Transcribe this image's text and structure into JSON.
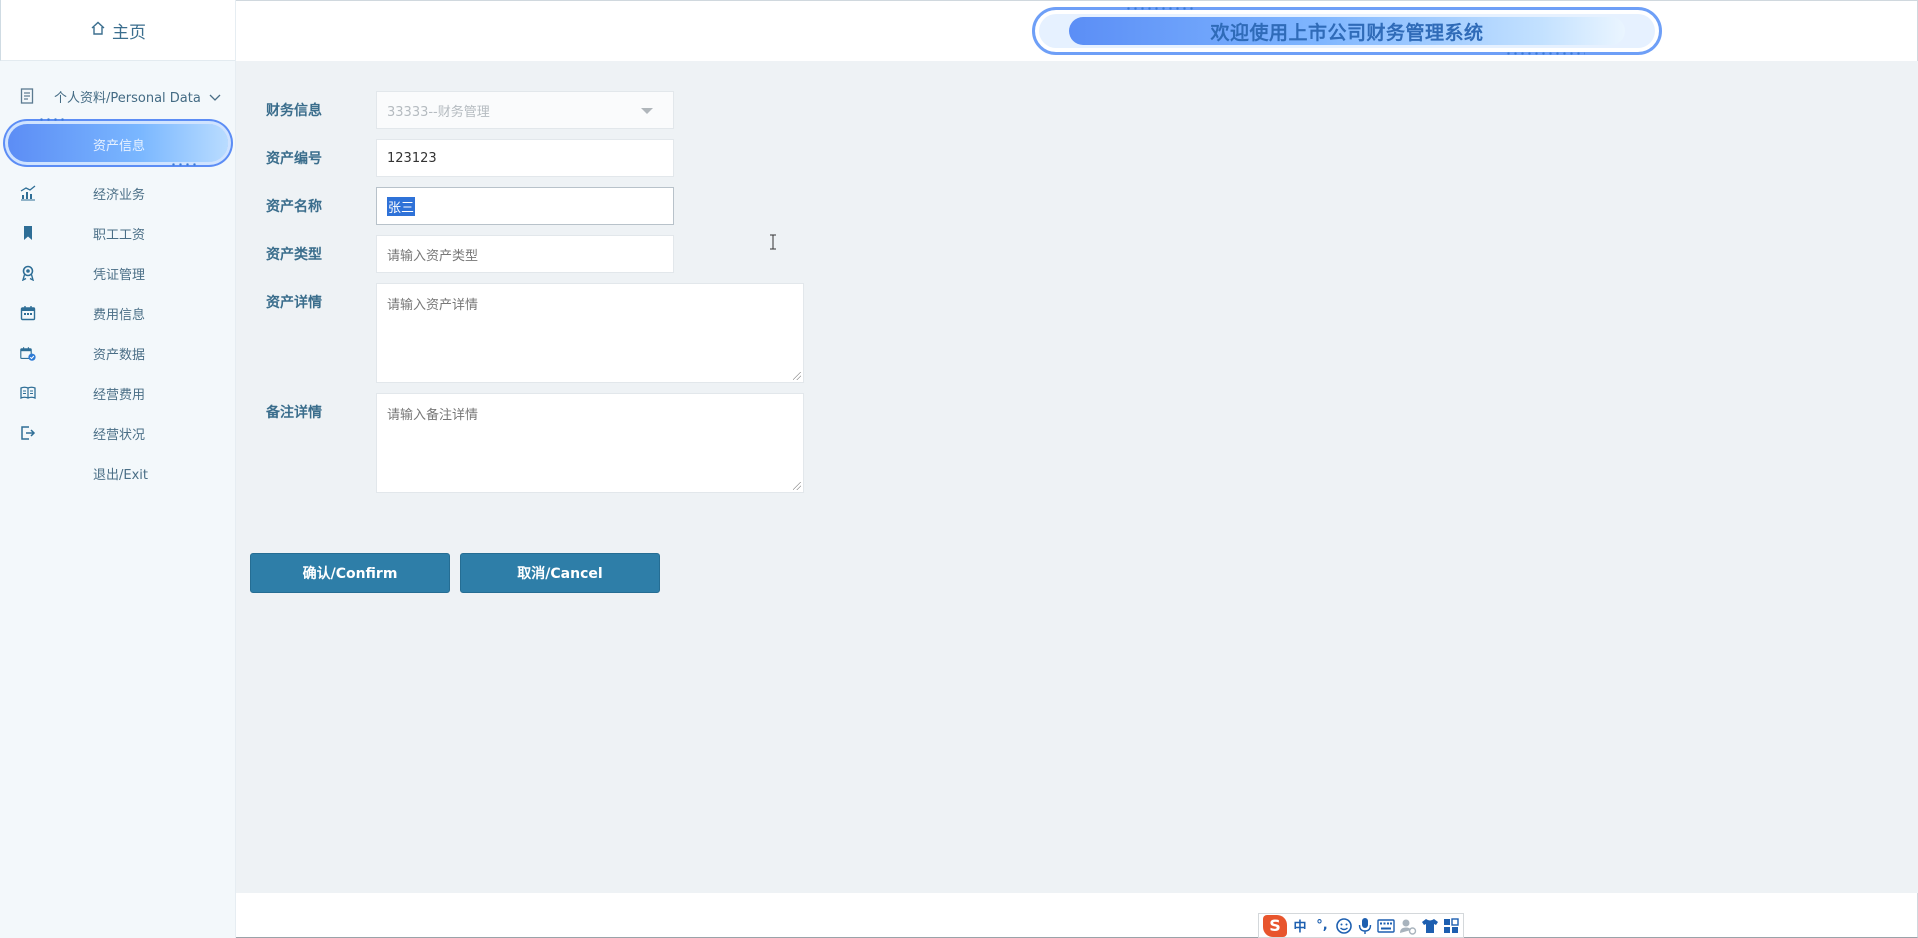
{
  "sidebar": {
    "home_label": "主页",
    "section_label": "个人资料/Personal Data",
    "items": [
      {
        "label": "资产信息",
        "icon": "active-item"
      },
      {
        "label": "经济业务",
        "icon": "chart-icon"
      },
      {
        "label": "职工工资",
        "icon": "bookmark-icon"
      },
      {
        "label": "凭证管理",
        "icon": "award-icon"
      },
      {
        "label": "费用信息",
        "icon": "calendar-icon"
      },
      {
        "label": "资产数据",
        "icon": "calendar-check-icon"
      },
      {
        "label": "经营费用",
        "icon": "book-icon"
      },
      {
        "label": "经营状况",
        "icon": "logout-icon"
      },
      {
        "label": "退出/Exit",
        "icon": ""
      }
    ]
  },
  "header": {
    "title": "欢迎使用上市公司财务管理系统"
  },
  "form": {
    "finance_label": "财务信息",
    "finance_value": "33333--财务管理",
    "asset_no_label": "资产编号",
    "asset_no_value": "123123",
    "asset_name_label": "资产名称",
    "asset_name_value": "张三",
    "asset_type_label": "资产类型",
    "asset_type_placeholder": "请输入资产类型",
    "asset_detail_label": "资产详情",
    "asset_detail_placeholder": "请输入资产详情",
    "remark_label": "备注详情",
    "remark_placeholder": "请输入备注详情",
    "confirm_label": "确认/Confirm",
    "cancel_label": "取消/Cancel"
  },
  "ime": {
    "logo": "S",
    "mode": "中",
    "punct": "°,"
  },
  "colors": {
    "primary_button": "#2e7ea8",
    "label_text": "#3a6d8c",
    "content_bg": "#eef2f5",
    "sidebar_bg": "#f3f8fb",
    "active_pill": "#5c8df5"
  }
}
